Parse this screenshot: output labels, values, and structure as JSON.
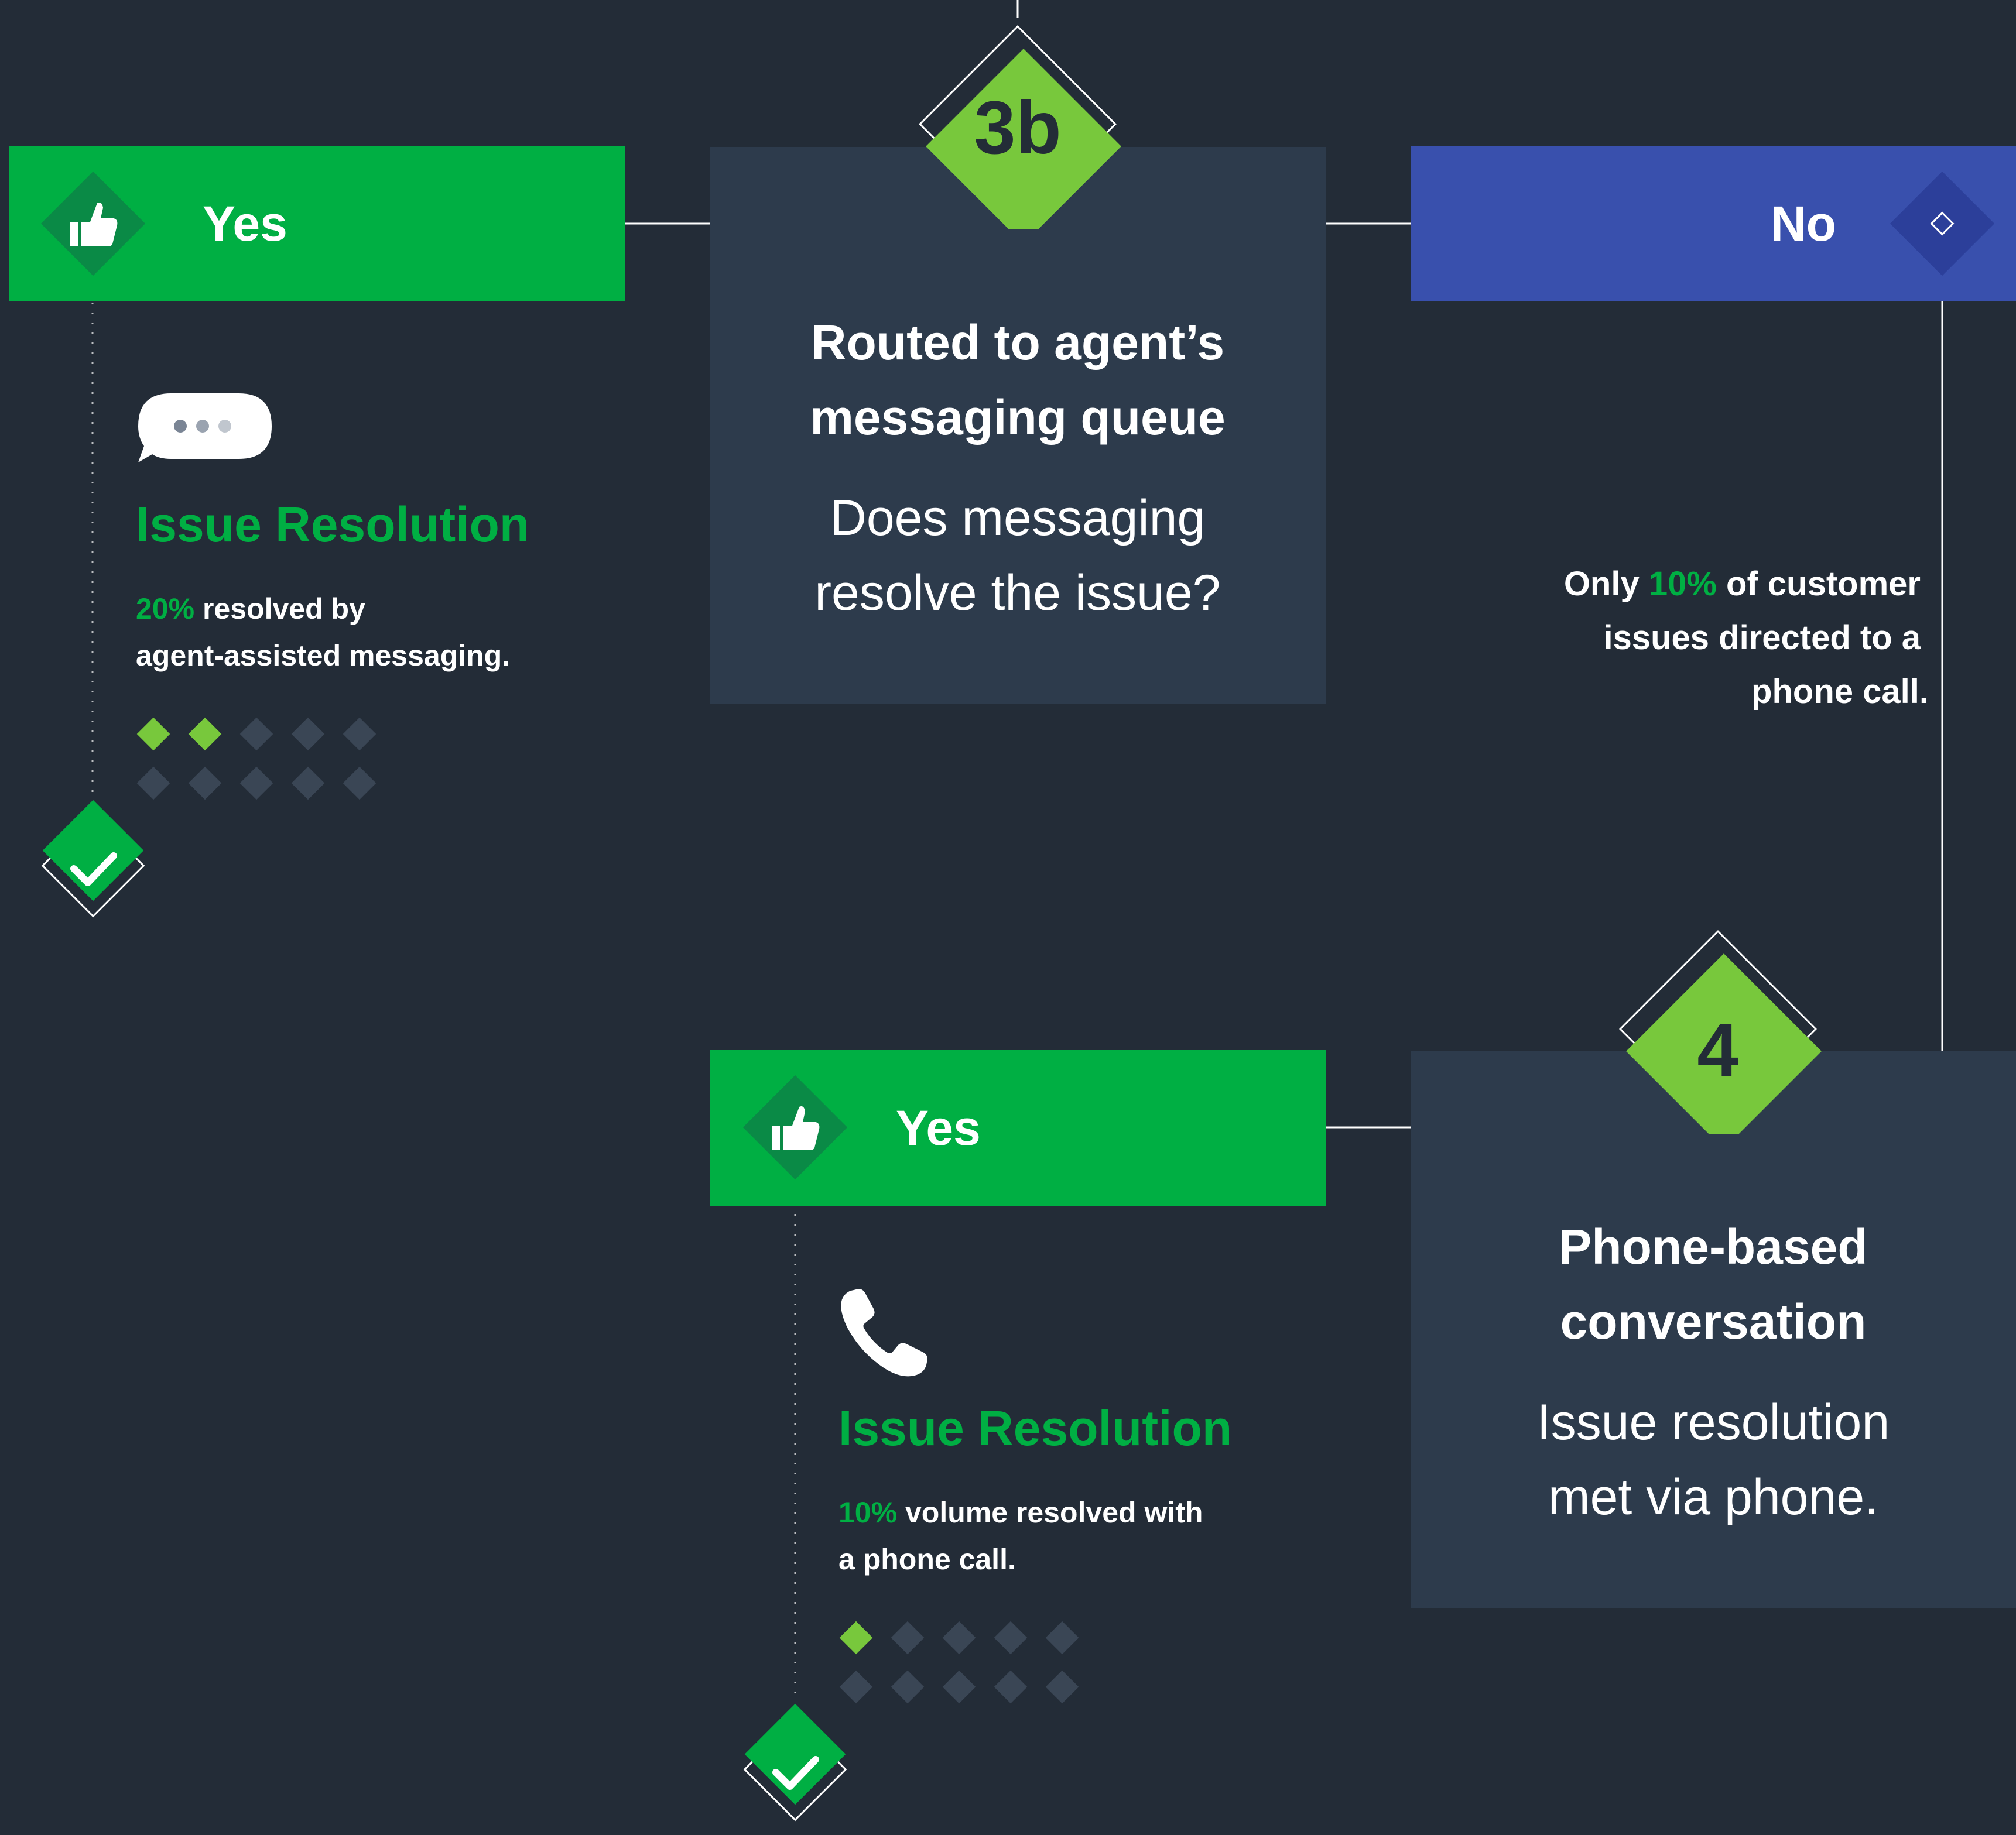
{
  "colors": {
    "background": "#232c37",
    "panel": "#2d3b4c",
    "yes_green": "#00af43",
    "badge_green": "#78c83c",
    "no_blue": "#3950ad",
    "dot_inactive": "#3a4655",
    "line": "#ffffff"
  },
  "top_yes": {
    "label": "Yes",
    "icon": "thumbs-up-icon"
  },
  "top_no": {
    "label": "No"
  },
  "step_3b": {
    "badge": "3b",
    "title_line1": "Routed to agent’s",
    "title_line2": "messaging queue",
    "question_line1": "Does messaging",
    "question_line2": "resolve the issue?"
  },
  "resolution_messaging": {
    "icon": "chat-bubble-icon",
    "title": "Issue Resolution",
    "percent": "20%",
    "text_line1": " resolved by",
    "text_line2": "agent-assisted messaging.",
    "dots_filled": 2,
    "dots_total": 10
  },
  "note_no": {
    "prefix": "Only ",
    "percent": "10%",
    "line1_suffix": " of customer",
    "line2": "issues directed to a",
    "line3": "phone call."
  },
  "step_4": {
    "badge": "4",
    "title_line1": "Phone-based",
    "title_line2": "conversation",
    "desc_line1": "Issue resolution",
    "desc_line2": "met via phone."
  },
  "bottom_yes": {
    "label": "Yes",
    "icon": "thumbs-up-icon"
  },
  "resolution_phone": {
    "icon": "phone-icon",
    "title": "Issue Resolution",
    "percent": "10%",
    "text_line1": " volume resolved with",
    "text_line2": "a phone call.",
    "dots_filled": 1,
    "dots_total": 10
  }
}
